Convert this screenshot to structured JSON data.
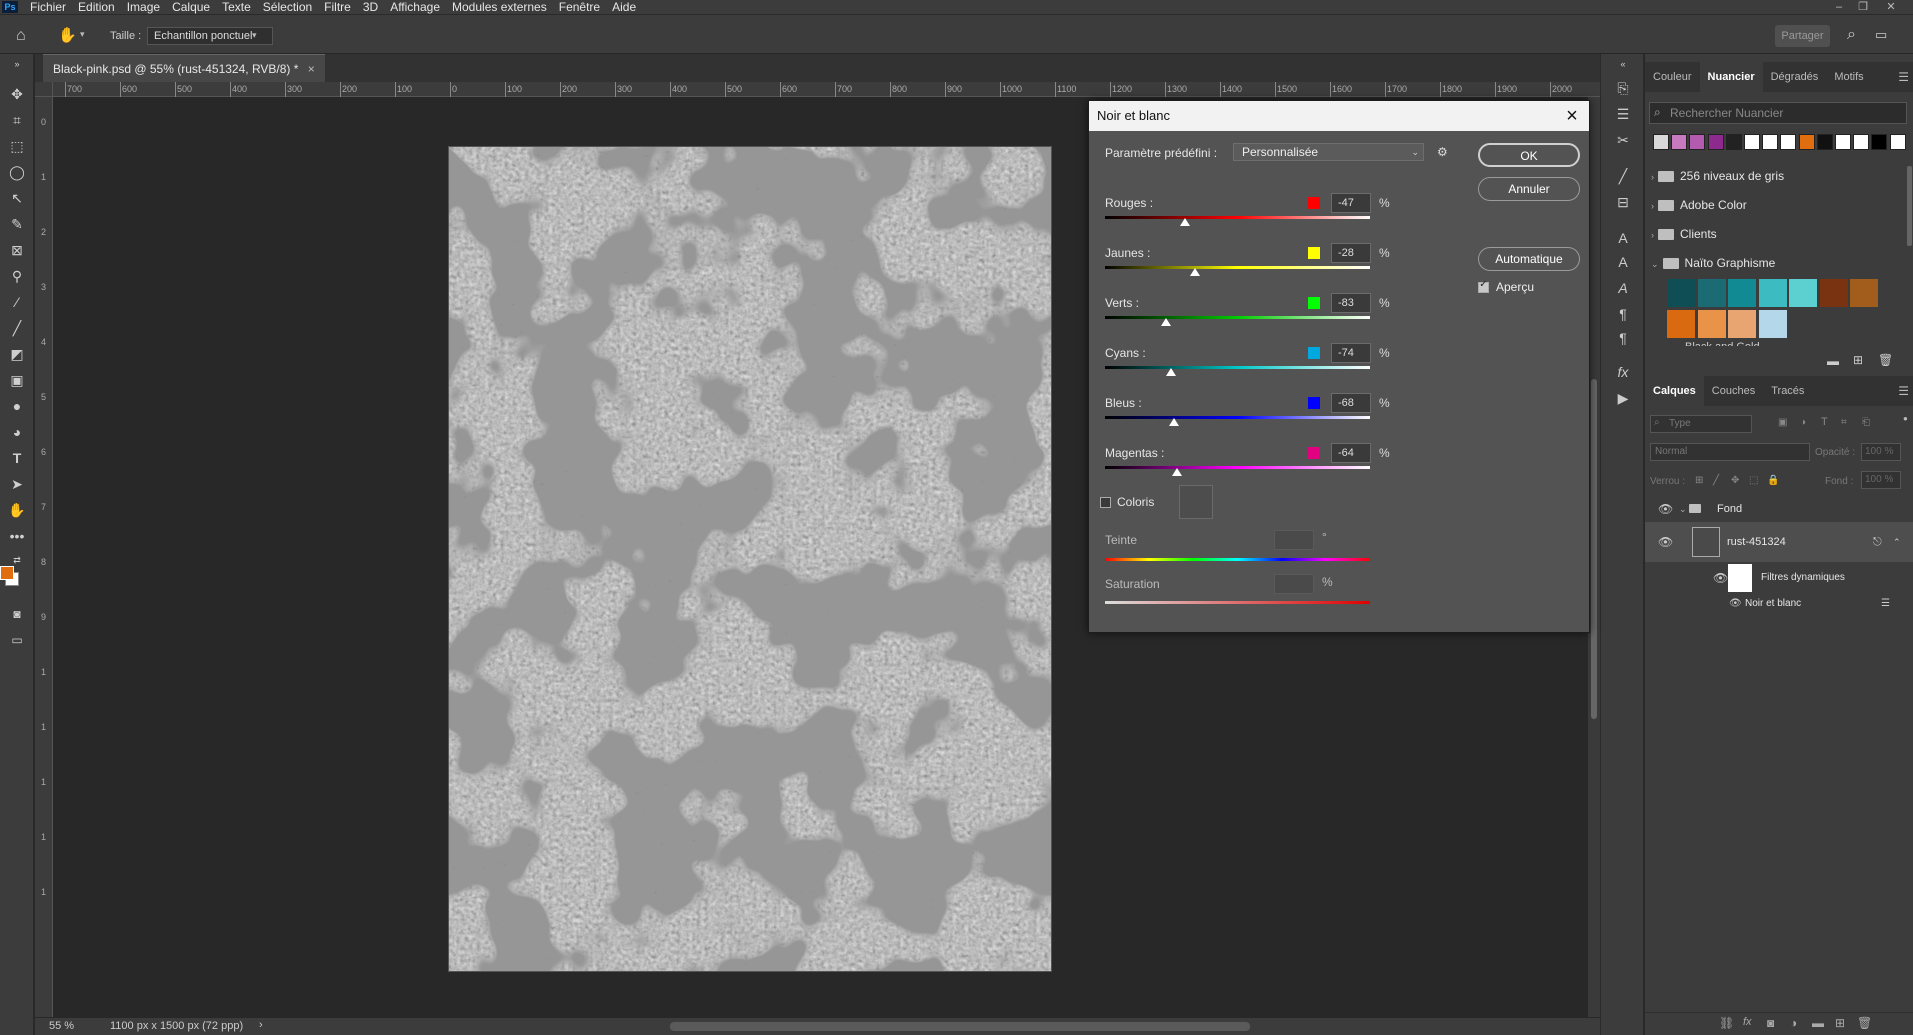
{
  "menubar": {
    "logo": "Ps",
    "items": [
      "Fichier",
      "Edition",
      "Image",
      "Calque",
      "Texte",
      "Sélection",
      "Filtre",
      "3D",
      "Affichage",
      "Modules externes",
      "Fenêtre",
      "Aide"
    ]
  },
  "options": {
    "size_label": "Taille :",
    "size_value": "Echantillon ponctuel",
    "share": "Partager"
  },
  "document": {
    "tab_title": "Black-pink.psd @ 55% (rust-451324, RVB/8) *",
    "tab_close": "×"
  },
  "ruler": {
    "h_ticks": [
      "700",
      "600",
      "500",
      "400",
      "300",
      "200",
      "100",
      "0",
      "100",
      "200",
      "300",
      "400",
      "500",
      "600",
      "700",
      "800",
      "900",
      "1000",
      "1100",
      "1200",
      "1300",
      "1400",
      "1500",
      "1600",
      "1700",
      "1800",
      "1900",
      "2000"
    ],
    "v_ticks": [
      "0",
      "1",
      "2",
      "3",
      "4",
      "5",
      "6",
      "7",
      "8",
      "9",
      "1",
      "1",
      "1",
      "1",
      "1"
    ]
  },
  "status": {
    "zoom": "55 %",
    "doc_size": "1100 px x 1500 px (72 ppp)",
    "arrow": "›"
  },
  "swatches_panel": {
    "tabs": [
      "Couleur",
      "Nuancier",
      "Dégradés",
      "Motifs"
    ],
    "active_tab": "Nuancier",
    "search_placeholder": "Rechercher Nuancier",
    "recent_colors": [
      "#d9d9d9",
      "#c77ac0",
      "#b25bb0",
      "#8e2a8e",
      "#222222",
      "#ffffff",
      "#ffffff",
      "#ffffff",
      "#e06d10",
      "#111111",
      "#ffffff",
      "#ffffff",
      "#000000",
      "#ffffff"
    ],
    "groups": [
      "256 niveaux de gris",
      "Adobe Color",
      "Clients",
      "Naïto Graphisme"
    ],
    "naito_colors": [
      "#0f4e55",
      "#1a6b73",
      "#128a93",
      "#3cbcc0",
      "#5ccfd0",
      "#7a3310",
      "#a25c1c",
      "#d96a10",
      "#e99348",
      "#e8a571",
      "#b5d7ea"
    ],
    "next_group": "Black and Gold"
  },
  "layers_panel": {
    "tabs": [
      "Calques",
      "Couches",
      "Tracés"
    ],
    "active_tab": "Calques",
    "filter": "Type",
    "blend": "Normal",
    "opacity_label": "Opacité :",
    "opacity": "100 %",
    "lock_label": "Verrou :",
    "fill_label": "Fond :",
    "fill": "100 %",
    "layers": {
      "group": "Fond",
      "layer": "rust-451324",
      "filters": "Filtres dynamiques",
      "filter_item": "Noir et blanc"
    }
  },
  "dialog": {
    "title": "Noir et blanc",
    "preset_label": "Paramètre prédéfini :",
    "preset_value": "Personnalisée",
    "ok": "OK",
    "cancel": "Annuler",
    "auto": "Automatique",
    "preview_label": "Aperçu",
    "preview_checked": true,
    "channels": [
      {
        "label": "Rouges :",
        "value": "-47",
        "percent": "%",
        "color": "#ff0000",
        "grad": "linear-gradient(to right,#000,#ff0000,#fff)",
        "pos": 0.3
      },
      {
        "label": "Jaunes :",
        "value": "-28",
        "percent": "%",
        "color": "#ffff00",
        "grad": "linear-gradient(to right,#000,#ffff00,#fff)",
        "pos": 0.34
      },
      {
        "label": "Verts :",
        "value": "-83",
        "percent": "%",
        "color": "#00ff00",
        "grad": "linear-gradient(to right,#000,#00cc00,#fff)",
        "pos": 0.23
      },
      {
        "label": "Cyans :",
        "value": "-74",
        "percent": "%",
        "color": "#00a8e0",
        "grad": "linear-gradient(to right,#000,#00c8c8,#fff)",
        "pos": 0.25
      },
      {
        "label": "Bleus :",
        "value": "-68",
        "percent": "%",
        "color": "#0000ff",
        "grad": "linear-gradient(to right,#000,#0000ff,#fff)",
        "pos": 0.26
      },
      {
        "label": "Magentas :",
        "value": "-64",
        "percent": "%",
        "color": "#e00080",
        "grad": "linear-gradient(to right,#000,#ff00ff,#fff)",
        "pos": 0.27
      }
    ],
    "colorize_label": "Colorize",
    "colorize_text": "Coloris",
    "hue_label": "Teinte",
    "hue_unit": "°",
    "saturation_label": "Saturation",
    "saturation_unit": "%"
  }
}
